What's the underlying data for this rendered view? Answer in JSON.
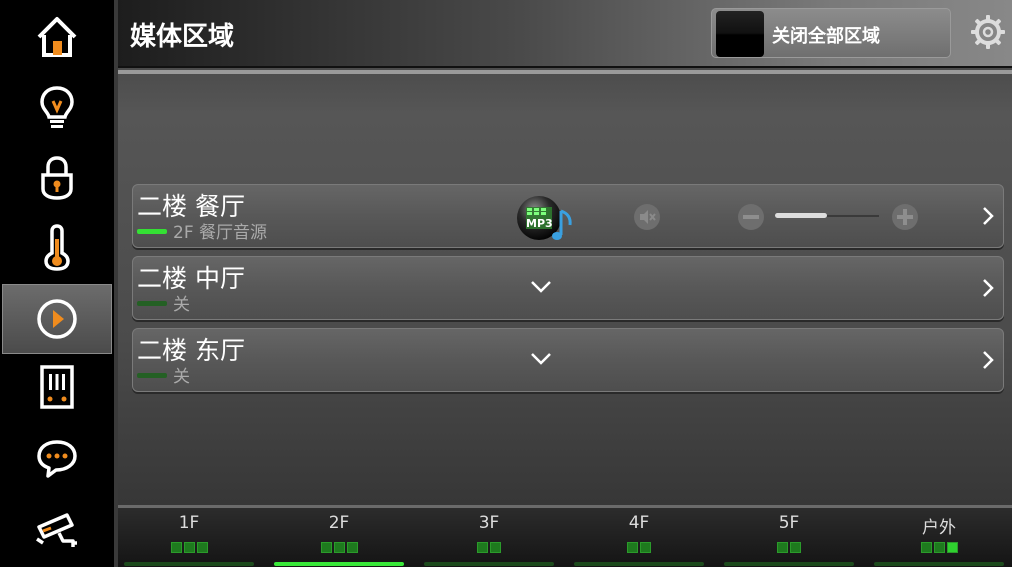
{
  "header": {
    "title": "媒体区域",
    "all_off_label": "关闭全部区域"
  },
  "sidebar": {
    "items": [
      {
        "icon": "home-icon"
      },
      {
        "icon": "bulb-icon"
      },
      {
        "icon": "lock-icon"
      },
      {
        "icon": "thermometer-icon"
      },
      {
        "icon": "play-icon",
        "active": true
      },
      {
        "icon": "panel-icon"
      },
      {
        "icon": "chat-icon"
      },
      {
        "icon": "camera-icon"
      }
    ]
  },
  "zones": [
    {
      "name": "二楼 餐厅",
      "status": "2F 餐厅音源",
      "on": true,
      "source_badge": "MP3",
      "volume_fraction": 0.5
    },
    {
      "name": "二楼 中厅",
      "status": "关",
      "on": false
    },
    {
      "name": "二楼 东厅",
      "status": "关",
      "on": false
    }
  ],
  "floors": [
    {
      "label": "1F",
      "squares": 3,
      "lit": 0
    },
    {
      "label": "2F",
      "squares": 3,
      "lit": 0,
      "active": true
    },
    {
      "label": "3F",
      "squares": 2,
      "lit": 0
    },
    {
      "label": "4F",
      "squares": 2,
      "lit": 0
    },
    {
      "label": "5F",
      "squares": 2,
      "lit": 0
    },
    {
      "label": "户外",
      "squares": 3,
      "lit": 1
    }
  ],
  "colors": {
    "accent_orange": "#f08c1e",
    "status_on": "#34e034",
    "status_off": "#246024"
  }
}
